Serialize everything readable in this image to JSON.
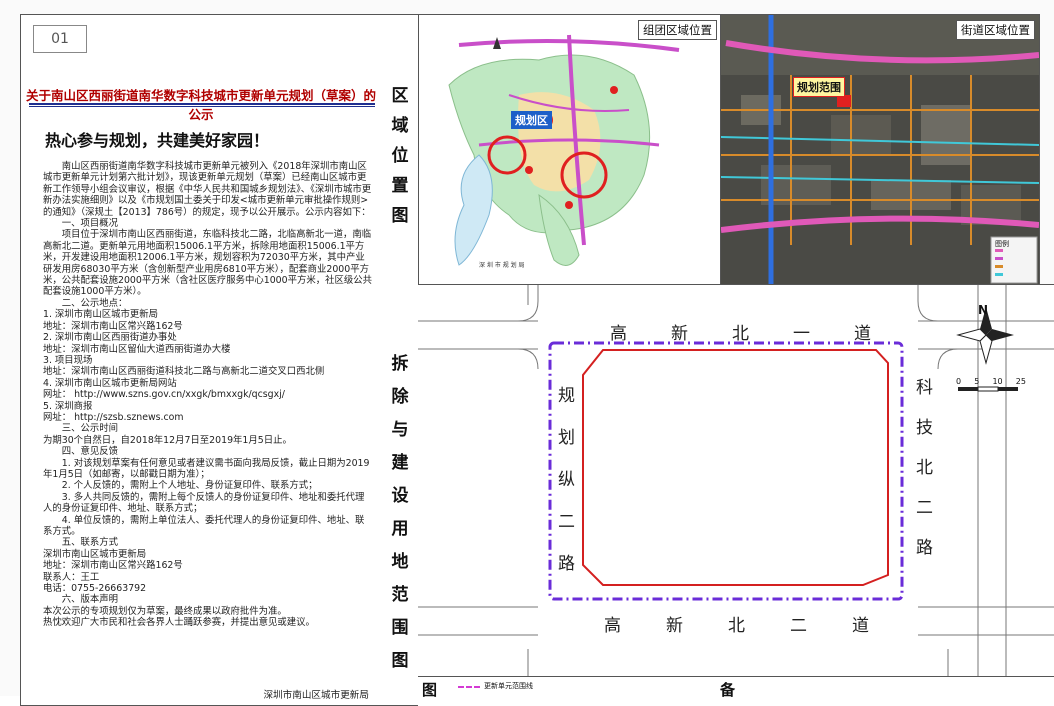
{
  "page_number": "01",
  "notice_title": "关于南山区西丽街道南华数字科技城市更新单元规划（草案）的公示",
  "slogan": "热心参与规划，共建美好家园！",
  "body_lines": [
    "南山区西丽街道南华数字科技城市更新单元被列入《2018年深圳市南山区城市更新单元计划第六批计划》，现该更新单元规划（草案）已经南山区城市更新工作领导小组会议审议，根据《中华人民共和国城乡规划法》、《深圳市城市更新办法实施细则》以及《市规划国土委关于印发<城市更新单元审批操作规则>的通知》（深规土【2013】786号）的规定，现予以公开展示。公示内容如下：",
    "一、项目概况",
    "项目位于深圳市南山区西丽街道，东临科技北二路，北临高新北一道，南临高新北二道。更新单元用地面积15006.1平方米，拆除用地面积15006.1平方米，开发建设用地面积12006.1平方米，规划容积为72030平方米，其中产业研发用房68030平方米（含创新型产业用房6810平方米），配套商业2000平方米，公共配套设施2000平方米（含社区医疗服务中心1000平方米，社区级公共配套设施1000平方米）。",
    "二、公示地点：",
    "1. 深圳市南山区城市更新局",
    "地址：深圳市南山区常兴路162号",
    "2. 深圳市南山区西丽街道办事处",
    "地址：深圳市南山区留仙大道西丽街道办大楼",
    "3. 项目现场",
    "地址：深圳市南山区西丽街道科技北二路与高新北二道交叉口西北侧",
    "4. 深圳市南山区城市更新局网站",
    "网址： http://www.szns.gov.cn/xxgk/bmxxgk/qcsgxj/",
    "5. 深圳商报",
    "网址： http://szsb.sznews.com",
    "三、公示时间",
    "为期30个自然日，自2018年12月7日至2019年1月5日止。",
    "四、意见反馈",
    "1. 对该规划草案有任何意见或者建议需书面向我局反馈，截止日期为2019年1月5日（如邮寄，以邮戳日期为准）；",
    "2. 个人反馈的，需附上个人地址、身份证复印件、联系方式；",
    "3. 多人共同反馈的，需附上每个反馈人的身份证复印件、地址和委托代理人的身份证复印件、地址、联系方式；",
    "4. 单位反馈的，需附上单位法人、委托代理人的身份证复印件、地址、联系方式。",
    "五、联系方式",
    "深圳市南山区城市更新局",
    "地址：深圳市南山区常兴路162号",
    "联系人：王工",
    "电话：0755-26663792",
    "六、版本声明",
    "本次公示的专项规划仅为草案，最终成果以政府批件为准。",
    "热忱欢迎广大市民和社会各界人士踊跃参赛，并提出意见或建议。"
  ],
  "signature": "深圳市南山区城市更新局",
  "vertical_label_top": [
    "区",
    "域",
    "位",
    "置",
    "图"
  ],
  "vertical_label_bottom": [
    "拆",
    "除",
    "与",
    "建",
    "设",
    "用",
    "地",
    "范",
    "围",
    "图"
  ],
  "map1_tag": "组团区域位置",
  "map1_marker": "规划区",
  "map2_tag": "街道区域位置",
  "map2_marker": "规划范围",
  "legend_title": "图例",
  "roads": {
    "north": [
      "高",
      "新",
      "北",
      "一",
      "道"
    ],
    "south": [
      "高",
      "新",
      "北",
      "二",
      "道"
    ],
    "east": [
      "科",
      "技",
      "北",
      "二",
      "路"
    ],
    "west": [
      "规",
      "划",
      "纵",
      "二",
      "路"
    ]
  },
  "north_label": "N",
  "scale_labels": [
    "0",
    "5",
    "10",
    "25"
  ],
  "bottom_left_char": "图",
  "bottom_right_char": "备",
  "bottom_legend_text": "更新单元范围线",
  "colors": {
    "title_red": "#b00000",
    "title_bar": "#1f2f8f",
    "boundary_purple": "#6a2cd8",
    "site_red": "#d42020"
  }
}
